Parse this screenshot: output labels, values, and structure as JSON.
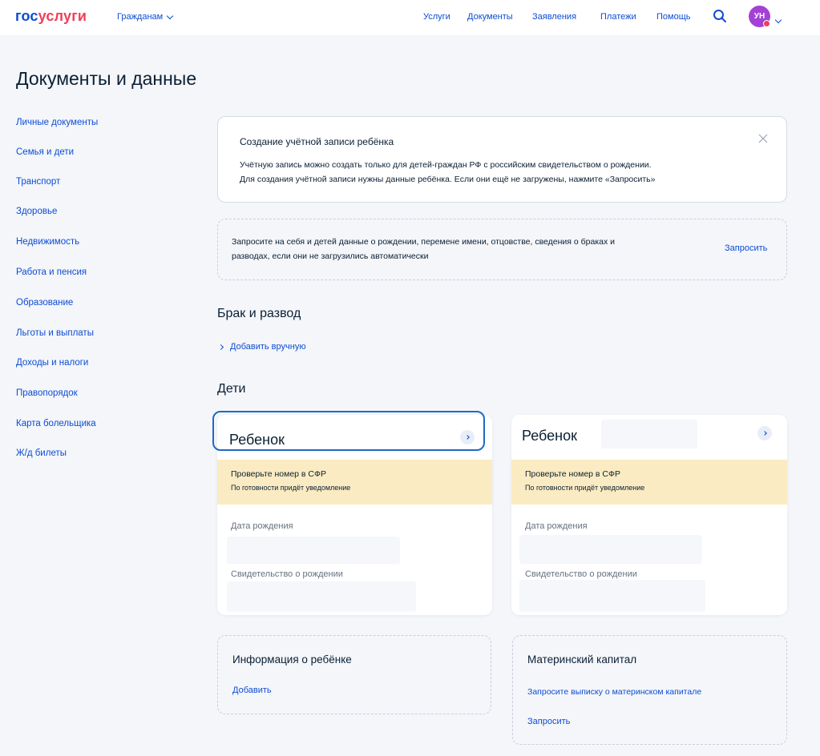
{
  "header": {
    "logo_part1": "гос",
    "logo_part2": "услуги",
    "citizens_label": "Гражданам",
    "nav": [
      "Услуги",
      "Документы",
      "Заявления",
      "Платежи",
      "Помощь"
    ],
    "avatar_initials": "УН",
    "brand_blue": "#0d4cd3",
    "brand_red": "#ee3f58",
    "avatar_color": "#a341d6"
  },
  "page_title": "Документы и данные",
  "sidebar": {
    "items": [
      "Личные документы",
      "Семья и дети",
      "Транспорт",
      "Здоровье",
      "Недвижимость",
      "Работа и пенсия",
      "Образование",
      "Льготы и выплаты",
      "Доходы и налоги",
      "Правопорядок",
      "Карта болельщика",
      "Ж/д билеты"
    ]
  },
  "notice": {
    "title": "Создание учётной записи ребёнка",
    "line1": "Учётную запись можно создать только для детей-граждан РФ с российским свидетельством о рождении.",
    "line2": "Для создания учётной записи нужны данные ребёнка. Если они ещё не загружены, нажмите «Запросить»"
  },
  "request": {
    "line1": "Запросите на себя и детей данные о рождении, перемене имени, отцовстве, сведения о браках и",
    "line2": "разводах, если они не загрузились автоматически",
    "link": "Запросить"
  },
  "marriage": {
    "title": "Брак и развод",
    "add_manual": "Добавить вручную"
  },
  "children": {
    "title": "Дети",
    "cards": [
      {
        "name": "Ребенок",
        "warn_title": "Проверьте номер в СФР",
        "warn_sub": "По готовности придёт уведомление",
        "birth_label": "Дата рождения",
        "cert_label": "Свидетельство о рождении"
      },
      {
        "name": "Ребенок",
        "warn_title": "Проверьте номер в СФР",
        "warn_sub": "По готовности придёт уведомление",
        "birth_label": "Дата рождения",
        "cert_label": "Свидетельство о рождении"
      }
    ],
    "warn_color": "#fbebc2"
  },
  "info_card": {
    "title": "Информация о ребёнке",
    "link": "Добавить"
  },
  "maternity": {
    "title": "Материнский капитал",
    "text": "Запросите выписку о материнском капитале",
    "link": "Запросить"
  },
  "icons": [
    "chevron-down-icon",
    "search-icon",
    "close-icon",
    "chevron-right-icon"
  ]
}
